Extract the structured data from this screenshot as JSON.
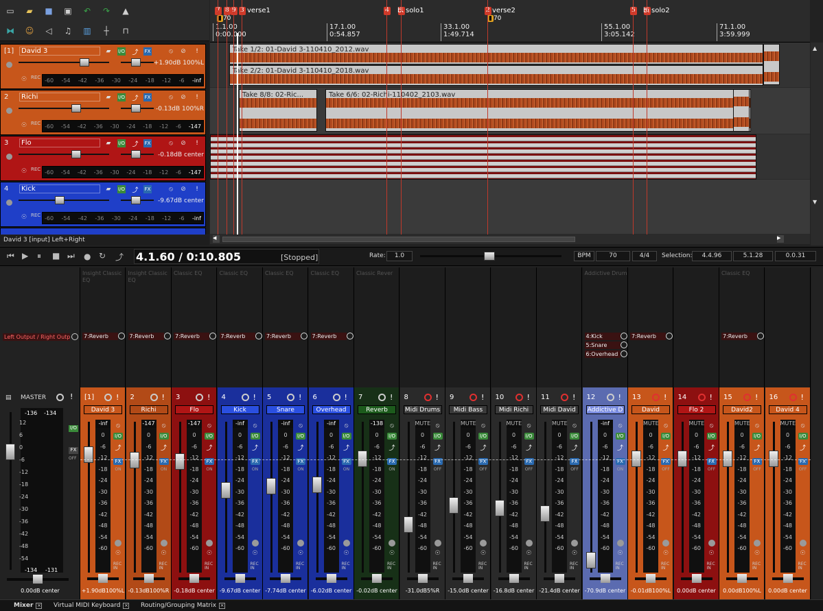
{
  "toolbar": {
    "icons": [
      "new-file-icon",
      "open-folder-icon",
      "save-icon",
      "save-as-icon",
      "undo-icon",
      "redo-icon",
      "metronome-icon",
      "ripple-icon",
      "people-icon",
      "speaker-icon",
      "midi-icon",
      "grid-icon",
      "split-icon",
      "lock-icon"
    ]
  },
  "tracks": [
    {
      "num": "[1]",
      "name": "David 3",
      "vol": "+1.90dB 100%L",
      "color": "#c7561b",
      "fader": 0.75,
      "meter_end": "-inf"
    },
    {
      "num": "2",
      "name": "Richi",
      "vol": "-0.13dB 100%R",
      "color": "#c7561b",
      "fader": 0.65,
      "meter_end": "-147"
    },
    {
      "num": "3",
      "name": "Flo",
      "vol": "-0.18dB center",
      "color": "#b01515",
      "fader": 0.65,
      "meter_end": "-147"
    },
    {
      "num": "4",
      "name": "Kick",
      "vol": "-9.67dB center",
      "color": "#1f3fc8",
      "fader": 0.45,
      "meter_end": "-inf"
    }
  ],
  "track_meter_scale": [
    "-60",
    "-54",
    "-42",
    "-36",
    "-30",
    "-24",
    "-18",
    "-12",
    "-6"
  ],
  "rec_in": "REC IN",
  "status_line": "David 3 [input] Left+Right",
  "ruler": {
    "marks": [
      {
        "bar": "1.1.00",
        "time": "0:00.000"
      },
      {
        "bar": "17.1.00",
        "time": "0:54.857"
      },
      {
        "bar": "33.1.00",
        "time": "1:49.714"
      },
      {
        "bar": "55.1.00",
        "time": "3:05.142"
      },
      {
        "bar": "71.1.00",
        "time": "3:59.999"
      }
    ],
    "tempo": [
      "70",
      "70"
    ],
    "markers": [
      {
        "ids": [
          "7",
          "8",
          "9",
          "3"
        ],
        "label": "verse1"
      },
      {
        "ids": [
          "4",
          "1"
        ],
        "label": "solo1",
        "prefix": "b."
      },
      {
        "ids": [
          "2"
        ],
        "label": "verse2"
      },
      {
        "ids": [
          "5",
          "6"
        ],
        "label": "solo2",
        "prefix": "b."
      }
    ]
  },
  "clips": [
    {
      "label": "Take 1/2: 01-David 3-110410_2012.wav"
    },
    {
      "label": "Take 2/2: 01-David 3-110410_2018.wav"
    },
    {
      "label": "Take 8/8: 02-Ric..."
    },
    {
      "label": "Take 6/6: 02-Richi-110402_2103.wav"
    }
  ],
  "transport": {
    "position": "4.1.60 / 0:10.805",
    "state": "[Stopped]",
    "rate_label": "Rate:",
    "rate": "1.0",
    "bpm_label": "BPM",
    "bpm": "70",
    "timesig": "4/4",
    "selection_label": "Selection:",
    "sel_start": "4.4.96",
    "sel_end": "5.1.28",
    "sel_len": "0.0.31"
  },
  "master": {
    "name": "MASTER",
    "route": "Left Output / Right Outp",
    "peak_l": "-136",
    "peak_r": "-134",
    "low_l": "-134",
    "low_r": "-131",
    "vol": "0.00dB center",
    "scale": [
      "12",
      "6",
      "0",
      "-6",
      "-12",
      "-18",
      "-24",
      "-30",
      "-36",
      "-42",
      "-48",
      "-54"
    ]
  },
  "mixer_scale": [
    "0",
    "-6",
    "-12",
    "-18",
    "-24",
    "-30",
    "-36",
    "-42",
    "-48",
    "-54",
    "-60"
  ],
  "fx_labels": {
    "io": "I/O",
    "fx": "FX",
    "on": "ON",
    "off": "OFF",
    "rec": "REC IN"
  },
  "strips": [
    {
      "num": "[1]",
      "name": "David 3",
      "color": "#c7561b",
      "name_bg": "#c7561b",
      "plug": "Insight Classic EQ",
      "send": "7:Reverb",
      "peak": "-inf",
      "fader": 0.82,
      "vol": "+1.90dB100%L",
      "fx": "ON"
    },
    {
      "num": "2",
      "name": "Richi",
      "color": "#b24a17",
      "name_bg": "#b24a17",
      "plug": "Insight Classic EQ",
      "send": "7:Reverb",
      "peak": "-147",
      "fader": 0.78,
      "vol": "-0.13dB100%R",
      "fx": "ON"
    },
    {
      "num": "3",
      "name": "Flo",
      "color": "#8d1010",
      "name_bg": "#b01515",
      "plug": "Classic EQ",
      "send": "7:Reverb",
      "peak": "-147",
      "fader": 0.77,
      "vol": "-0.18dB center",
      "fx": "ON"
    },
    {
      "num": "4",
      "name": "Kick",
      "color": "#1a2f9c",
      "name_bg": "#2a4fe0",
      "plug": "Classic EQ",
      "send": "7:Reverb",
      "peak": "-inf",
      "fader": 0.56,
      "vol": "-9.67dB center",
      "fx": "ON"
    },
    {
      "num": "5",
      "name": "Snare",
      "color": "#1a2f9c",
      "name_bg": "#2a4fe0",
      "plug": "Classic EQ",
      "send": "7:Reverb",
      "peak": "-inf",
      "fader": 0.59,
      "vol": "-7.74dB center",
      "fx": "ON"
    },
    {
      "num": "6",
      "name": "Overhead",
      "color": "#1a2f9c",
      "name_bg": "#2a4fe0",
      "plug": "Classic EQ",
      "send": "7:Reverb",
      "peak": "-inf",
      "fader": 0.6,
      "vol": "-6.02dB center",
      "fx": "ON"
    },
    {
      "num": "7",
      "name": "Reverb",
      "color": "#173017",
      "name_bg": "#1c5a1c",
      "plug": "Classic Rever",
      "send": "",
      "peak": "-138",
      "fader": 0.79,
      "vol": "-0.02dB center",
      "fx": "ON"
    },
    {
      "num": "8",
      "name": "Midi Drums",
      "color": "#2a2a2a",
      "name_bg": "#3a3a3a",
      "plug": "",
      "send": "",
      "peak": "MUTE",
      "fader": 0.31,
      "vol": "-31.0dB5%R",
      "fx": "OFF"
    },
    {
      "num": "9",
      "name": "Midi Bass",
      "color": "#2a2a2a",
      "name_bg": "#3a3a3a",
      "plug": "",
      "send": "",
      "peak": "MUTE",
      "fader": 0.45,
      "vol": "-15.0dB center",
      "fx": "OFF"
    },
    {
      "num": "10",
      "name": "Midi Richi",
      "color": "#2a2a2a",
      "name_bg": "#3a3a3a",
      "plug": "",
      "send": "",
      "peak": "MUTE",
      "fader": 0.43,
      "vol": "-16.8dB center",
      "fx": "OFF"
    },
    {
      "num": "11",
      "name": "Midi David",
      "color": "#2a2a2a",
      "name_bg": "#3a3a3a",
      "plug": "",
      "send": "",
      "peak": "MUTE",
      "fader": 0.39,
      "vol": "-21.4dB center",
      "fx": "OFF"
    },
    {
      "num": "12",
      "name": "Addictive D",
      "color": "#5b6bb0",
      "name_bg": "#7a8ce0",
      "plug": "Addictive Drum",
      "send": "4:Kick",
      "sends": [
        "5:Snare",
        "6:Overhead"
      ],
      "peak": "-inf",
      "fader": 0.05,
      "vol": "-70.9dB center",
      "fx": "ON"
    },
    {
      "num": "13",
      "name": "David",
      "color": "#c7561b",
      "name_bg": "#c7561b",
      "plug": "",
      "send": "7:Reverb",
      "peak": "MUTE",
      "fader": 0.79,
      "vol": "-0.01dB100%L",
      "fx": "OFF"
    },
    {
      "num": "14",
      "name": "Flo 2",
      "color": "#8d1010",
      "name_bg": "#b01515",
      "plug": "",
      "send": "",
      "peak": "MUTE",
      "fader": 0.79,
      "vol": "0.00dB center",
      "fx": "OFF"
    },
    {
      "num": "15",
      "name": "David2",
      "color": "#c7561b",
      "name_bg": "#c7561b",
      "plug": "Classic EQ",
      "send": "7:Reverb",
      "peak": "MUTE",
      "fader": 0.79,
      "vol": "0.00dB100%L",
      "fx": "OFF"
    },
    {
      "num": "16",
      "name": "David 4",
      "color": "#c7561b",
      "name_bg": "#c7561b",
      "plug": "",
      "send": "",
      "peak": "MUTE",
      "fader": 0.79,
      "vol": "0.00dB center",
      "fx": "OFF"
    }
  ],
  "tabs": [
    {
      "label": "Mixer"
    },
    {
      "label": "Virtual MIDI Keyboard"
    },
    {
      "label": "Routing/Grouping Matrix"
    }
  ],
  "colors": {
    "orange": "#c7561b",
    "red": "#b01515",
    "blue": "#1f3fc8",
    "green": "#1c5a1c",
    "marker": "#c0392b"
  }
}
